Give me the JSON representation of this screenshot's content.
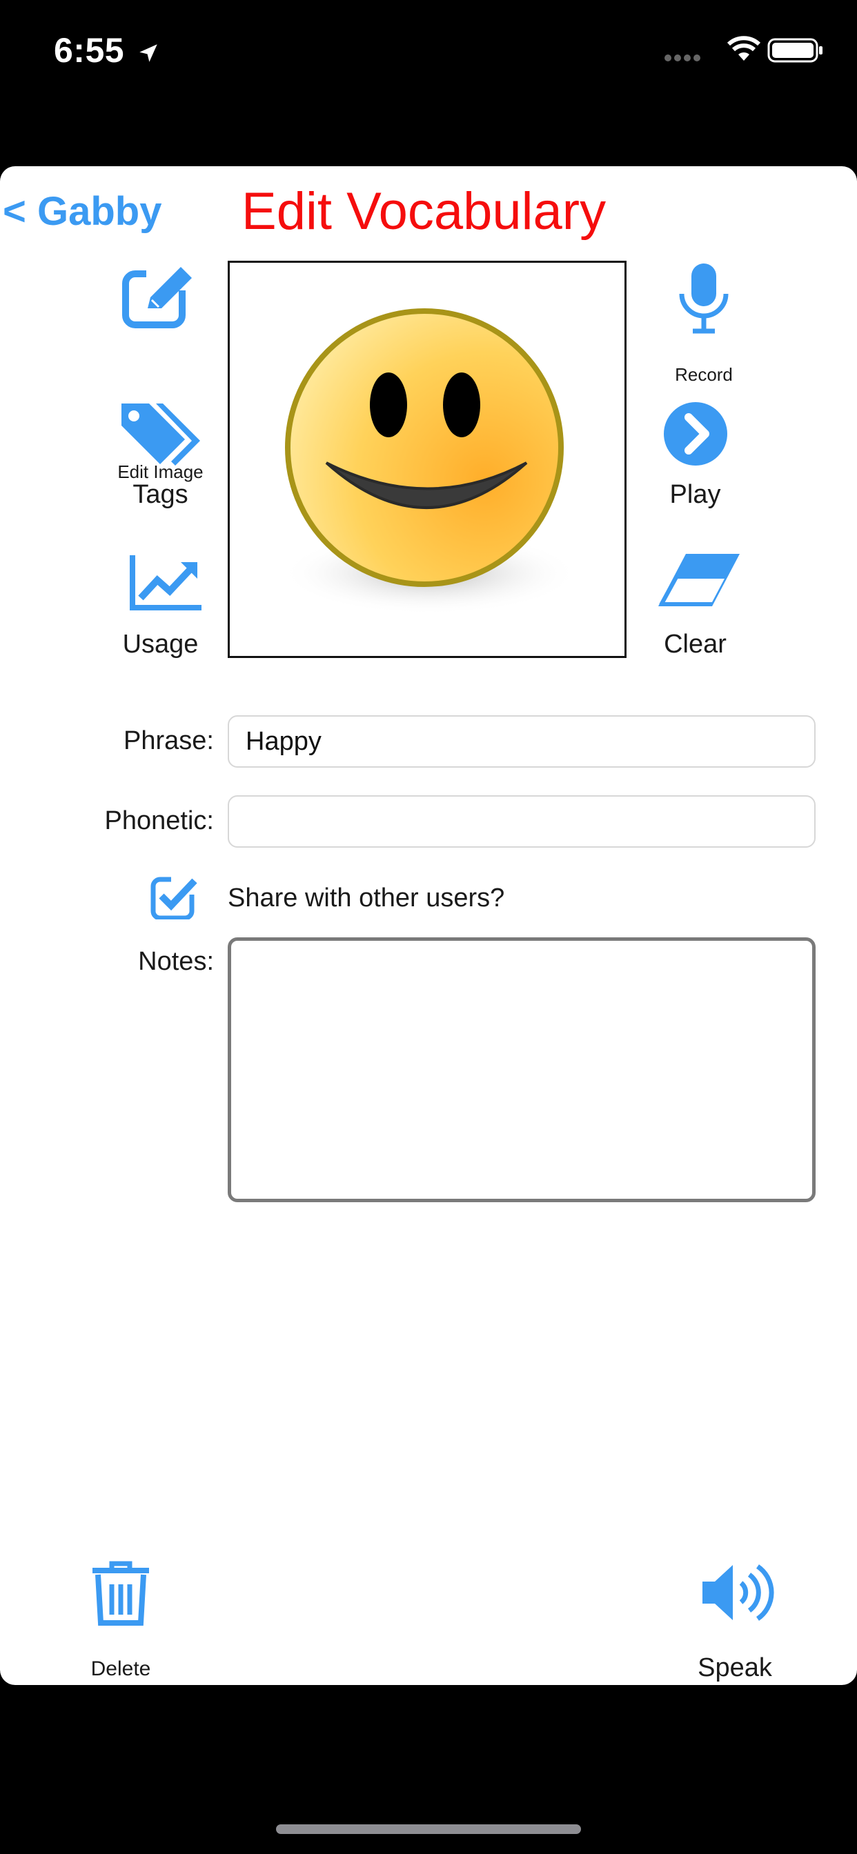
{
  "status_bar": {
    "time": "6:55"
  },
  "nav": {
    "back_label": "< Gabby",
    "title": "Edit Vocabulary"
  },
  "left_tools": [
    {
      "label": "Edit Image",
      "icon": "edit-image-icon"
    },
    {
      "label": "Tags",
      "icon": "tags-icon"
    },
    {
      "label": "Usage",
      "icon": "usage-chart-icon"
    }
  ],
  "right_tools": [
    {
      "label": "Record",
      "icon": "microphone-icon"
    },
    {
      "label": "Play",
      "icon": "play-icon"
    },
    {
      "label": "Clear",
      "icon": "eraser-icon"
    }
  ],
  "image": {
    "icon": "smiley-face-icon"
  },
  "form": {
    "phrase_label": "Phrase:",
    "phrase_value": "Happy",
    "phonetic_label": "Phonetic:",
    "phonetic_value": "",
    "share_label": "Share with other users?",
    "share_checked": true,
    "notes_label": "Notes:",
    "notes_value": ""
  },
  "bottom": {
    "delete_label": "Delete",
    "speak_label": "Speak"
  },
  "colors": {
    "accent": "#3b9af2",
    "title": "#f50d0d",
    "background": "#ffffff",
    "frame": "#000000"
  }
}
